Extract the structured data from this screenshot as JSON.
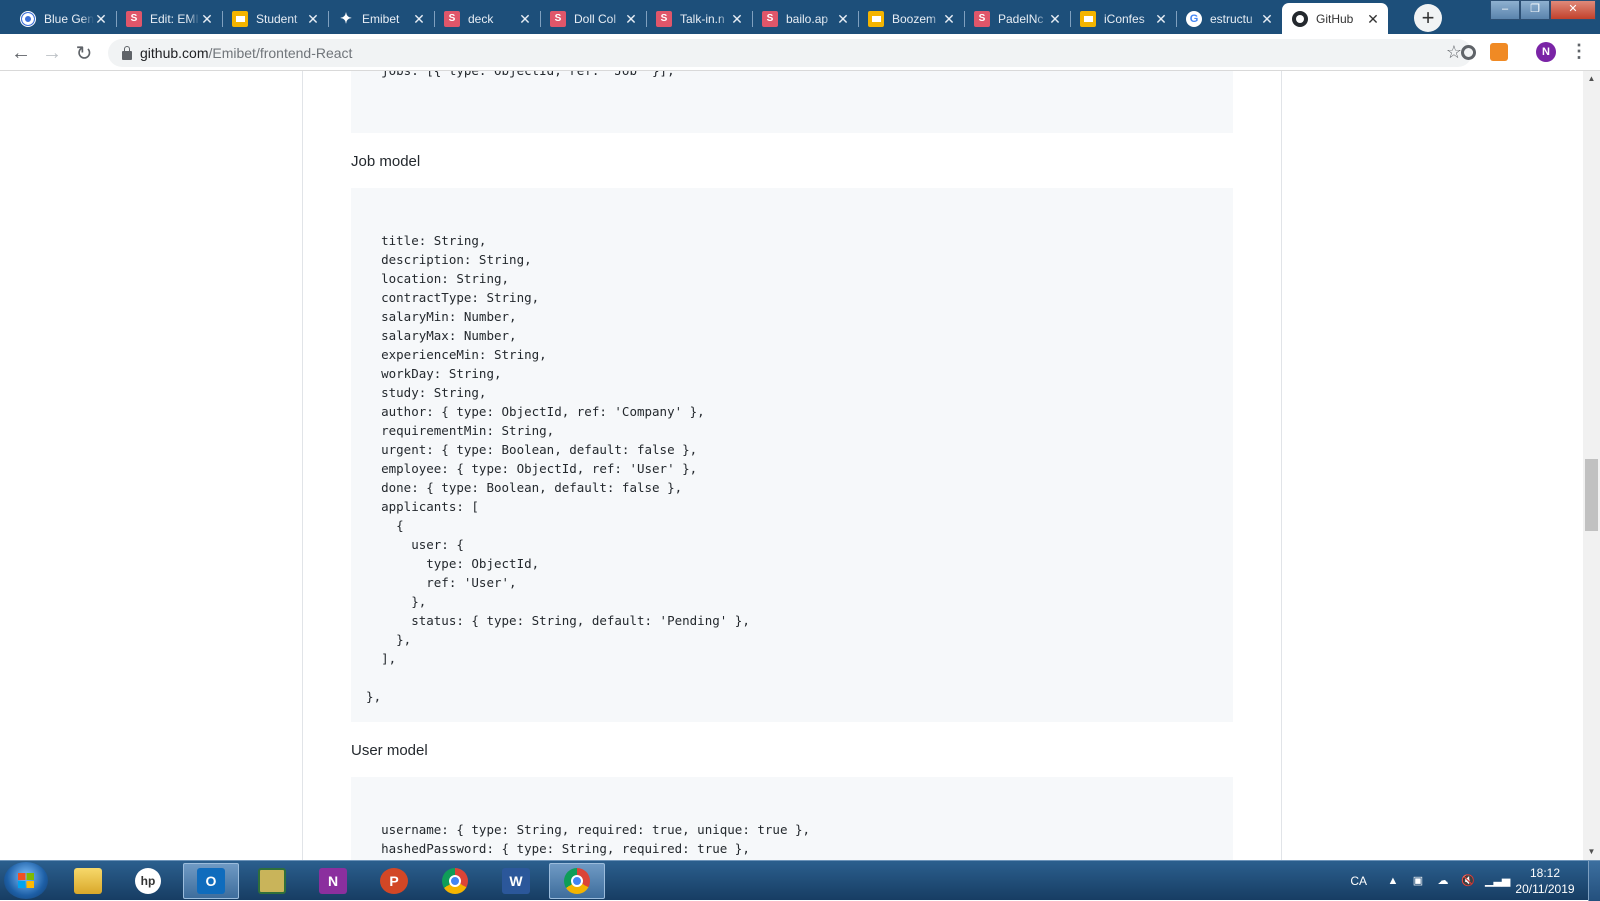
{
  "browser": {
    "tabs": [
      {
        "title": "Blue Gen",
        "favicon": "blue-circle-icon"
      },
      {
        "title": "Edit: EMI",
        "favicon": "s-icon"
      },
      {
        "title": "Student",
        "favicon": "slides-icon"
      },
      {
        "title": "Emibet",
        "favicon": "emibet-icon"
      },
      {
        "title": "deck",
        "favicon": "s-icon"
      },
      {
        "title": "Doll Col",
        "favicon": "s-icon"
      },
      {
        "title": "Talk-in.n",
        "favicon": "s-icon"
      },
      {
        "title": "bailo.ap",
        "favicon": "s-icon"
      },
      {
        "title": "Boozem",
        "favicon": "slides-icon"
      },
      {
        "title": "PadelNc",
        "favicon": "s-icon"
      },
      {
        "title": "iConfes",
        "favicon": "slides-icon"
      },
      {
        "title": "estructu",
        "favicon": "google-icon"
      },
      {
        "title": "GitHub",
        "favicon": "github-icon",
        "active": true
      }
    ],
    "tab_close_glyph": "✕",
    "new_tab_glyph": "+",
    "url_host": "github.com",
    "url_path": "/Emibet/frontend-React",
    "profile_initial": "N"
  },
  "page": {
    "top_code_lines": [
      "    jobs: [{ type: ObjectId, ref: 'Job' }],"
    ],
    "job_model_heading": "Job model",
    "job_model_code": [
      "",
      "    title: String,",
      "    description: String,",
      "    location: String,",
      "    contractType: String,",
      "    salaryMin: Number,",
      "    salaryMax: Number,",
      "    experienceMin: String,",
      "    workDay: String,",
      "    study: String,",
      "    author: { type: ObjectId, ref: 'Company' },",
      "    requirementMin: String,",
      "    urgent: { type: Boolean, default: false },",
      "    employee: { type: ObjectId, ref: 'User' },",
      "    done: { type: Boolean, default: false },",
      "    applicants: [",
      "      {",
      "        user: {",
      "          type: ObjectId,",
      "          ref: 'User',",
      "        },",
      "        status: { type: String, default: 'Pending' },",
      "      },",
      "    ],",
      "",
      "  },"
    ],
    "user_model_heading": "User model",
    "user_model_code": [
      "",
      "    username: { type: String, required: true, unique: true },",
      "    hashedPassword: { type: String, required: true },"
    ]
  },
  "taskbar": {
    "apps": [
      {
        "name": "file-explorer",
        "icon": "folder-icon",
        "letter": ""
      },
      {
        "name": "hp-support",
        "icon": "hp-icon",
        "letter": "hp"
      },
      {
        "name": "outlook",
        "icon": "outlook-icon",
        "letter": "O",
        "active": true
      },
      {
        "name": "spreadsheet",
        "icon": "spreadsheet-icon",
        "letter": ""
      },
      {
        "name": "onenote",
        "icon": "onenote-icon",
        "letter": "N"
      },
      {
        "name": "powerpoint",
        "icon": "powerpoint-icon",
        "letter": "P"
      },
      {
        "name": "chrome",
        "icon": "chrome-icon",
        "letter": ""
      },
      {
        "name": "word",
        "icon": "word-icon",
        "letter": "W"
      },
      {
        "name": "chrome-active",
        "icon": "chrome-icon",
        "letter": "",
        "active": true
      }
    ],
    "language": "CA",
    "time": "18:12",
    "date": "20/11/2019"
  }
}
